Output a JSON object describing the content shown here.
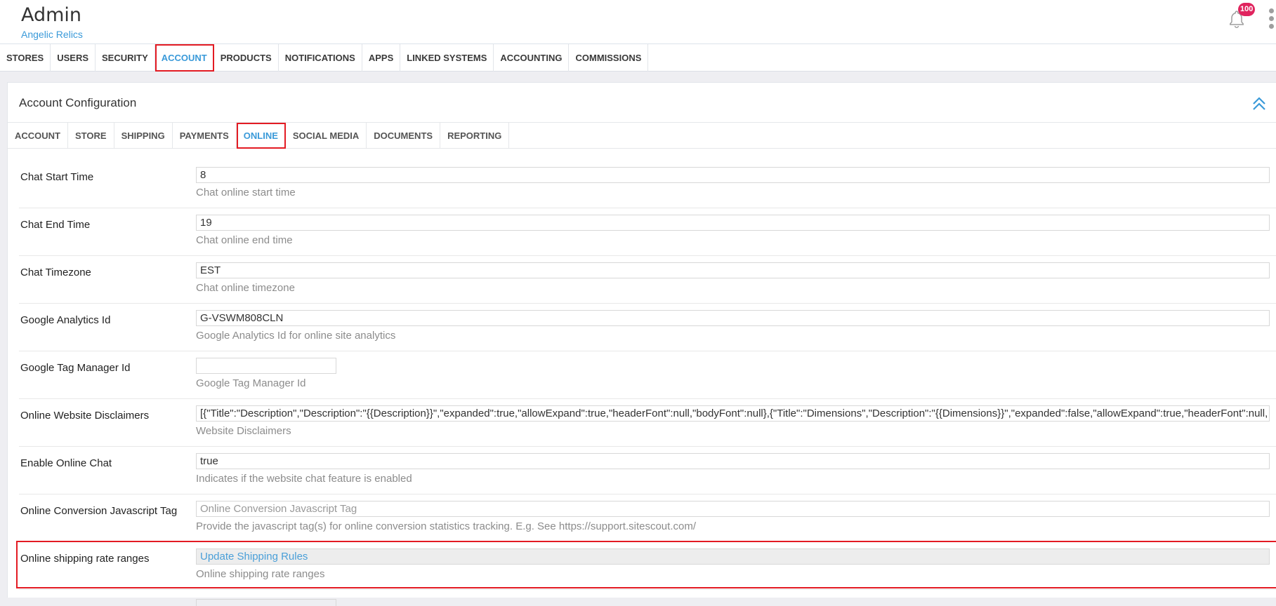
{
  "app": {
    "title": "Admin",
    "subtitle": "Angelic Relics",
    "notifications_count": "100"
  },
  "top_tabs": [
    {
      "label": "STORES"
    },
    {
      "label": "USERS"
    },
    {
      "label": "SECURITY"
    },
    {
      "label": "ACCOUNT",
      "active": true
    },
    {
      "label": "PRODUCTS"
    },
    {
      "label": "NOTIFICATIONS"
    },
    {
      "label": "APPS"
    },
    {
      "label": "LINKED SYSTEMS"
    },
    {
      "label": "ACCOUNTING"
    },
    {
      "label": "COMMISSIONS"
    }
  ],
  "panel": {
    "title": "Account Configuration",
    "sub_tabs": [
      {
        "label": "ACCOUNT"
      },
      {
        "label": "STORE"
      },
      {
        "label": "SHIPPING"
      },
      {
        "label": "PAYMENTS"
      },
      {
        "label": "ONLINE",
        "active": true
      },
      {
        "label": "SOCIAL MEDIA"
      },
      {
        "label": "DOCUMENTS"
      },
      {
        "label": "REPORTING"
      }
    ]
  },
  "rows": [
    {
      "label": "Chat Start Time",
      "value": "8",
      "help": "Chat online start time"
    },
    {
      "label": "Chat End Time",
      "value": "19",
      "help": "Chat online end time"
    },
    {
      "label": "Chat Timezone",
      "value": "EST",
      "help": "Chat online timezone"
    },
    {
      "label": "Google Analytics Id",
      "value": "G-VSWM808CLN",
      "help": "Google Analytics Id for online site analytics"
    },
    {
      "label": "Google Tag Manager Id",
      "value": "",
      "help": "Google Tag Manager Id"
    },
    {
      "label": "Online Website Disclaimers",
      "value": "[{\"Title\":\"Description\",\"Description\":\"{{Description}}\",\"expanded\":true,\"allowExpand\":true,\"headerFont\":null,\"bodyFont\":null},{\"Title\":\"Dimensions\",\"Description\":\"{{Dimensions}}\",\"expanded\":false,\"allowExpand\":true,\"headerFont\":null,",
      "help": "Website Disclaimers"
    },
    {
      "label": "Enable Online Chat",
      "value": "true",
      "help": "Indicates if the website chat feature is enabled"
    },
    {
      "label": "Online Conversion Javascript Tag",
      "placeholder": "Online Conversion Javascript Tag",
      "help": "Provide the javascript tag(s) for online conversion statistics tracking. E.g. See https://support.sitescout.com/"
    },
    {
      "label": "Online shipping rate ranges",
      "button": "Update Shipping Rules",
      "help": "Online shipping rate ranges"
    }
  ]
}
